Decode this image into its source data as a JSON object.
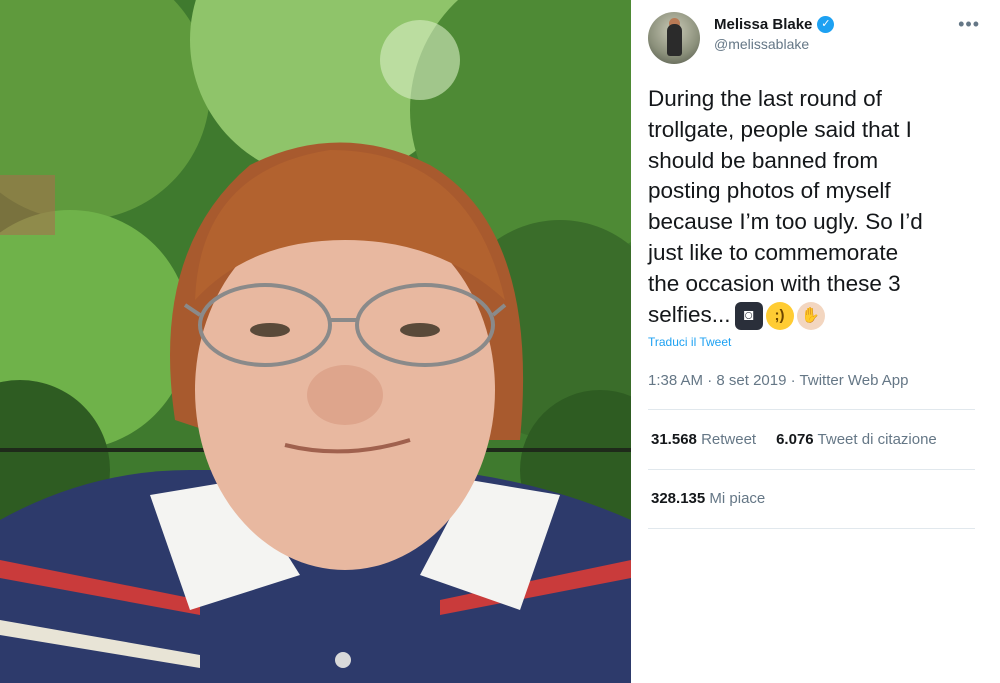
{
  "tweet": {
    "display_name": "Melissa Blake",
    "verified_mark": "✓",
    "handle": "@melissablake",
    "more_icon": "•••",
    "text": "During the last round of\ntrollgate, people said that I\nshould be banned from\nposting photos of myself\nbecause I’m too ugly. So I’d\njust like to commemorate\nthe occasion with these 3\nselfies...",
    "emojis": [
      "camera-with-flash",
      "winking-face",
      "waving-hand"
    ],
    "translate_label": "Traduci il Tweet",
    "time": "1:38 AM",
    "separator": "·",
    "date": "8 set 2019",
    "source": "Twitter Web App",
    "retweets_count": "31.568",
    "retweets_label": "Retweet",
    "quotes_count": "6.076",
    "quotes_label": "Tweet di citazione",
    "likes_count": "328.135",
    "likes_label": "Mi piace"
  },
  "colors": {
    "accent": "#1da1f2",
    "secondary_text": "#657786",
    "divider": "#e1e8ed"
  }
}
